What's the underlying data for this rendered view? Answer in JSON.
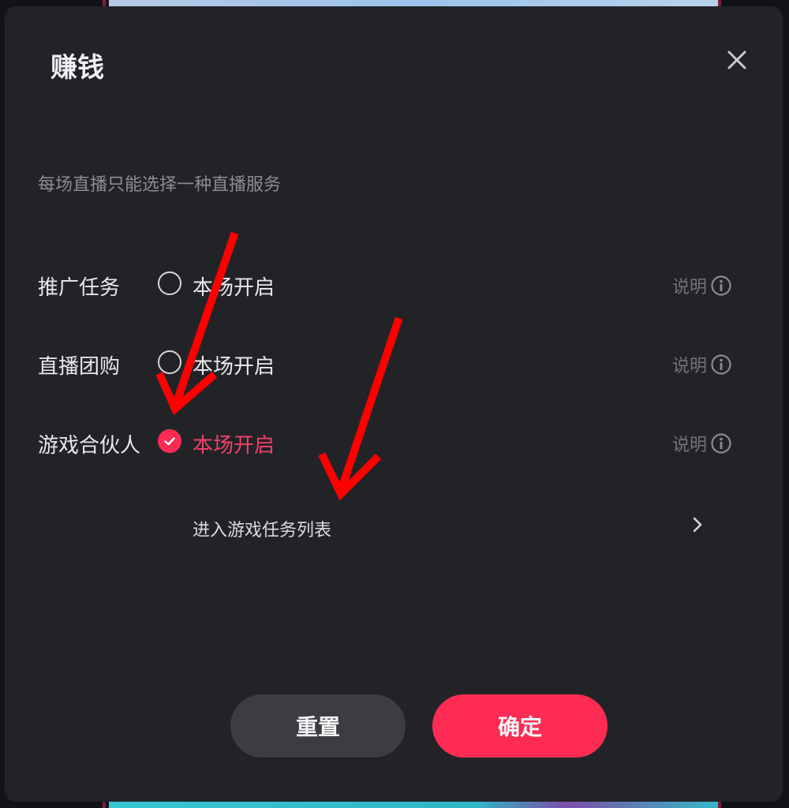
{
  "dialog": {
    "title": "赚钱",
    "hint": "每场直播只能选择一种直播服务"
  },
  "options": [
    {
      "label": "推广任务",
      "toggle_label": "本场开启",
      "checked": false,
      "info_label": "说明"
    },
    {
      "label": "直播团购",
      "toggle_label": "本场开启",
      "checked": false,
      "info_label": "说明"
    },
    {
      "label": "游戏合伙人",
      "toggle_label": "本场开启",
      "checked": true,
      "info_label": "说明"
    }
  ],
  "task_link": {
    "label": "进入游戏任务列表"
  },
  "buttons": {
    "reset": "重置",
    "confirm": "确定"
  },
  "icons": {
    "close": "close-icon",
    "info": "info-circle-icon",
    "chevron": "chevron-right-icon",
    "check": "check-icon"
  },
  "colors": {
    "accent": "#fe2c55",
    "annotation": "#ff0000",
    "dialog_bg": "#222327"
  }
}
